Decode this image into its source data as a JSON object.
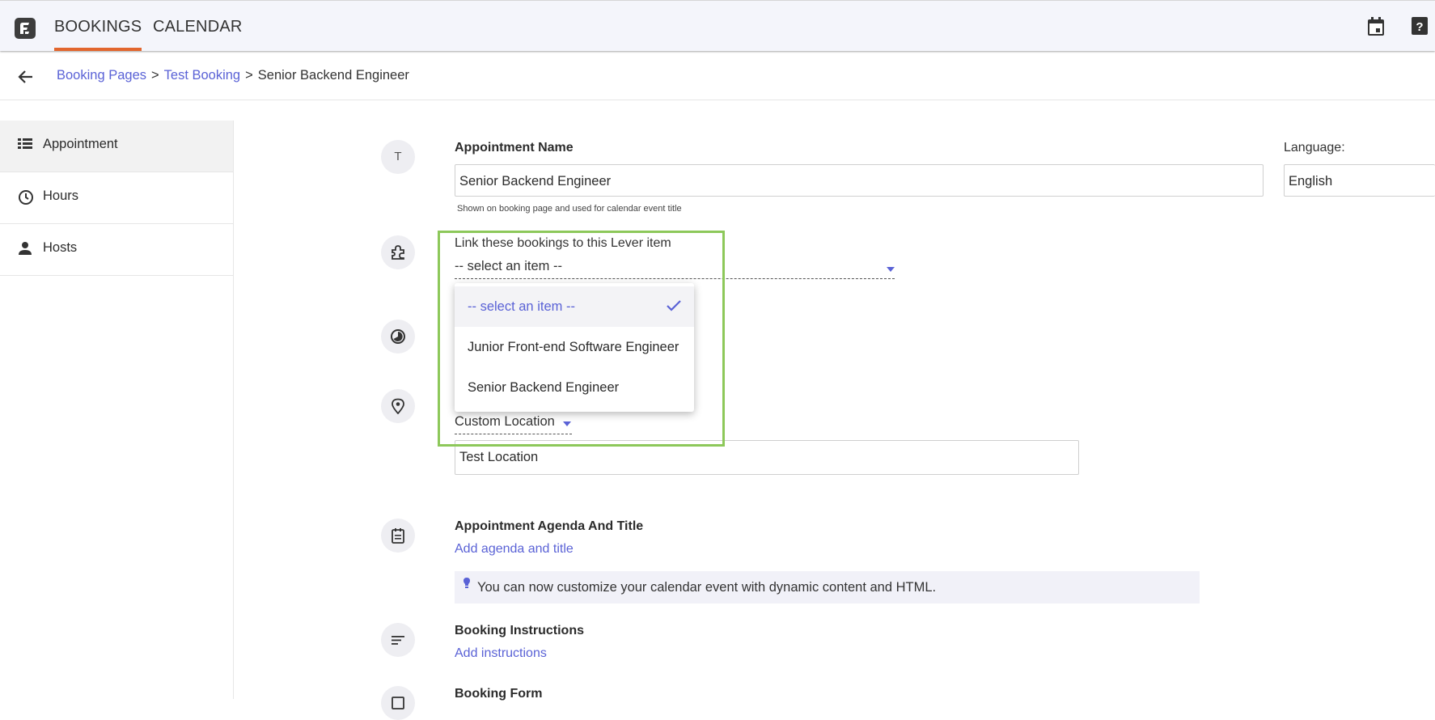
{
  "nav": {
    "tabs": [
      {
        "label": "BOOKINGS",
        "active": true
      },
      {
        "label": "CALENDAR",
        "active": false
      }
    ],
    "right_icons": [
      "calendar-icon",
      "help-icon"
    ],
    "accent": "#e2662e"
  },
  "breadcrumb": {
    "items": [
      "Booking Pages",
      "Test Booking",
      "Senior Backend Engineer"
    ],
    "separator": ">"
  },
  "sidebar": {
    "items": [
      {
        "label": "Appointment",
        "icon": "list-icon",
        "active": true
      },
      {
        "label": "Hours",
        "icon": "clock-icon",
        "active": false
      },
      {
        "label": "Hosts",
        "icon": "person-icon",
        "active": false
      }
    ]
  },
  "form": {
    "name_label": "Appointment Name",
    "name_value": "Senior Backend Engineer",
    "name_helper": "Shown on booking page and used for calendar event title",
    "language_label": "Language:",
    "language_value": "English",
    "lever_label": "Link these bookings to this Lever item",
    "lever_selected": "-- select an item --",
    "lever_options": [
      "-- select an item --",
      "Junior Front-end Software Engineer",
      "Senior Backend Engineer"
    ],
    "location_type": "Custom Location",
    "location_value": "Test Location",
    "agenda_label": "Appointment Agenda And Title",
    "agenda_link": "Add agenda and title",
    "tip_text": "You can now customize your calendar event with dynamic content and HTML.",
    "instructions_label": "Booking Instructions",
    "instructions_link": "Add instructions",
    "booking_form_label": "Booking Form"
  },
  "colors": {
    "link": "#5a62d6",
    "highlight": "#8dc85a"
  }
}
